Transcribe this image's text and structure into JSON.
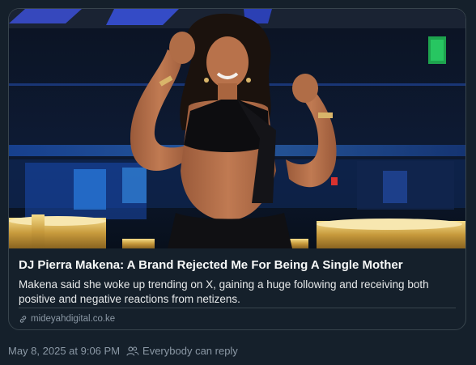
{
  "card": {
    "image_alt": "",
    "title": "DJ Pierra Makena: A Brand Rejected Me For Being A Single Mother",
    "description": "Makena said she woke up trending on X, gaining a huge following and receiving both positive and negative reactions from netizens.",
    "domain": "mideyahdigital.co.ke",
    "domain_icon": "link-icon"
  },
  "meta": {
    "timestamp": "May 8, 2025 at 9:06 PM",
    "reply_icon": "people-icon",
    "reply_setting": "Everybody can reply"
  },
  "colors": {
    "background": "#15202b",
    "border": "#38444d",
    "muted_text": "#8b98a5",
    "accent_blue": "#2a6bd9"
  }
}
